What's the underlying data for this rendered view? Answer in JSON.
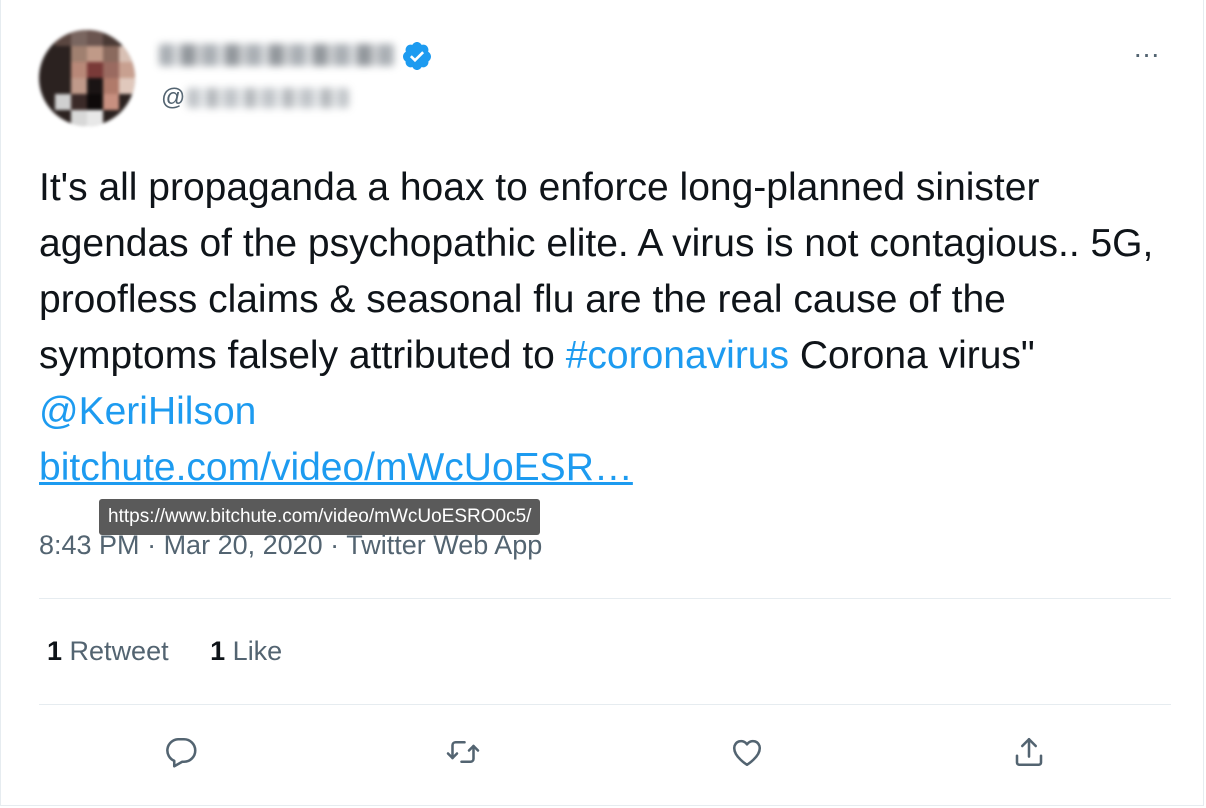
{
  "user": {
    "display_name": "",
    "handle_prefix": "@",
    "handle": "",
    "verified": true
  },
  "menu": {
    "more_label": "..."
  },
  "tweet": {
    "text_part1": "It's all propaganda a hoax to enforce long-planned sinister agendas of the psychopathic elite. A virus is not contagious.. 5G, proofless claims & seasonal flu are the real cause of the symptoms falsely attributed to ",
    "hashtag": "#coronavirus",
    "text_part2": " Corona virus\" ",
    "mention": "@KeriHilson",
    "link_display": "bitchute.com/video/mWcUoESR…",
    "link_tooltip": "https://www.bitchute.com/video/mWcUoESRO0c5/"
  },
  "meta": {
    "time": "8:43 PM",
    "date": "Mar 20, 2020",
    "source": "Twitter Web App",
    "sep": " · "
  },
  "stats": {
    "retweets_count": "1",
    "retweets_label": "Retweet",
    "likes_count": "1",
    "likes_label": "Like"
  },
  "actions": {
    "reply_icon": "reply-icon",
    "retweet_icon": "retweet-icon",
    "like_icon": "heart-icon",
    "share_icon": "share-icon"
  },
  "colors": {
    "link": "#1d9bf0",
    "verified": "#1d9bf0",
    "secondary": "#536471",
    "text": "#0f1419"
  }
}
